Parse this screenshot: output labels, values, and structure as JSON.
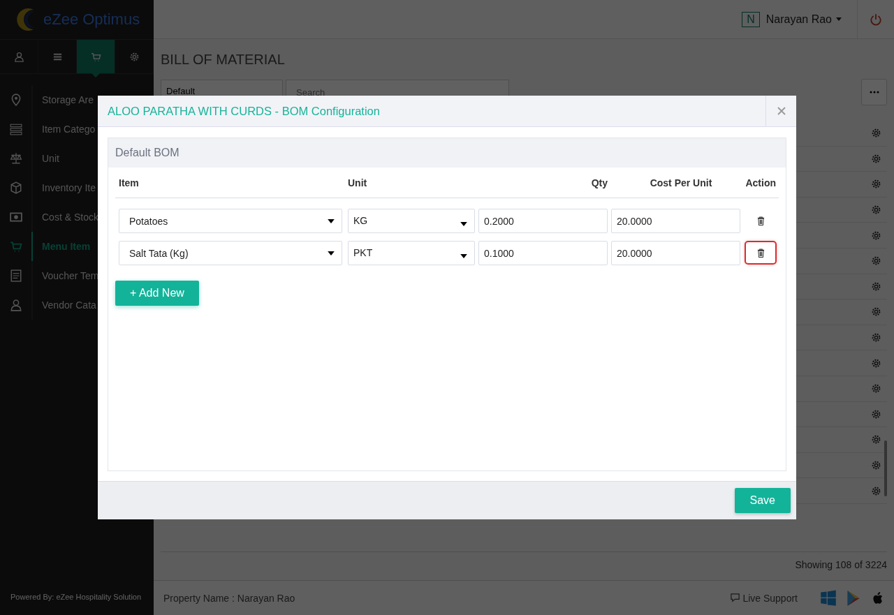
{
  "app": {
    "logo": "eZee Optimus",
    "user_initial": "N",
    "user_name": "Narayan Rao"
  },
  "sidebar": {
    "tabs": [
      {
        "kind": "user",
        "selected": false
      },
      {
        "kind": "menu",
        "selected": false
      },
      {
        "kind": "cart",
        "selected": true
      },
      {
        "kind": "settings",
        "selected": false
      }
    ],
    "items": [
      {
        "kind": "pin",
        "label": "Storage Are",
        "selected": false
      },
      {
        "kind": "list",
        "label": "Item Catego",
        "selected": false
      },
      {
        "kind": "scale",
        "label": "Unit",
        "selected": false
      },
      {
        "kind": "box",
        "label": "Inventory Ite",
        "selected": false
      },
      {
        "kind": "money",
        "label": "Cost & Stock",
        "selected": false
      },
      {
        "kind": "cart",
        "label": "Menu Item",
        "selected": true
      },
      {
        "kind": "voucher",
        "label": "Voucher Tem",
        "selected": false
      },
      {
        "kind": "user",
        "label": "Vendor Cata",
        "selected": false
      }
    ],
    "powered_by": "Powered By: eZee Hospitality Solution"
  },
  "page": {
    "title": "BILL OF MATERIAL",
    "filter": "Default",
    "search_placeholder": "Search",
    "list_rows": [
      {
        "kind": "gear"
      },
      {
        "kind": "gear"
      },
      {
        "kind": "gear"
      },
      {
        "kind": "gear"
      },
      {
        "kind": "gear"
      },
      {
        "kind": "gear"
      },
      {
        "kind": "gear"
      },
      {
        "kind": "gear"
      },
      {
        "kind": "gear"
      },
      {
        "kind": "gear"
      },
      {
        "kind": "gear"
      },
      {
        "kind": "gear"
      },
      {
        "kind": "gear"
      },
      {
        "kind": "gear"
      },
      {
        "kind": "gear"
      }
    ],
    "showing": "Showing 108 of 3224"
  },
  "footer": {
    "property": "Property Name : Narayan Rao",
    "live_support": "Live Support"
  },
  "modal": {
    "title": "ALOO PARATHA WITH CURDS - BOM Configuration",
    "section": "Default BOM",
    "columns": [
      "Item",
      "Unit",
      "Qty",
      "Cost Per Unit",
      "Action"
    ],
    "rows": [
      {
        "item": "Potatoes",
        "unit": "KG",
        "qty": "0.2000",
        "cost": "20.0000",
        "highlighted": false
      },
      {
        "item": "Salt Tata (Kg)",
        "unit": "PKT",
        "qty": "0.1000",
        "cost": "20.0000",
        "highlighted": true
      }
    ],
    "add_button": "+ Add New",
    "save_button": "Save"
  }
}
